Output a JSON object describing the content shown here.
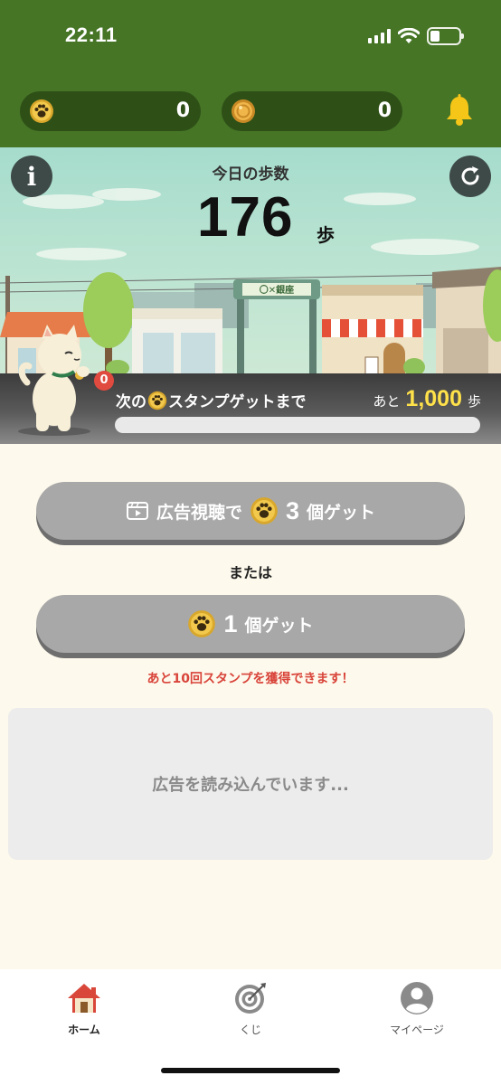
{
  "status_bar": {
    "time": "22:11"
  },
  "header": {
    "paw_count": "0",
    "coin_count": "0",
    "icons": {
      "paw": "paw-coin-icon",
      "coin": "gold-coin-icon",
      "bell": "bell-icon"
    }
  },
  "steps": {
    "title": "今日の歩数",
    "value": "176",
    "unit": "歩",
    "street_sign": "〇✕銀座"
  },
  "progress": {
    "badge_count": "0",
    "label_prefix": "次の",
    "label_suffix": "スタンプゲットまで",
    "remain_prefix": "あと",
    "remain_value": "1,000",
    "remain_unit": "歩",
    "fraction": 0
  },
  "actions": {
    "ad_button": {
      "prefix": "広告視聴で",
      "count": "3",
      "suffix": "個ゲット"
    },
    "or_label": "または",
    "one_button": {
      "count": "1",
      "suffix": "個ゲット"
    },
    "remaining_note": "あと10回スタンプを獲得できます！"
  },
  "ad_placeholder": "広告を読み込んでいます...",
  "tabs": [
    {
      "label": "ホーム",
      "icon": "home-icon",
      "active": true
    },
    {
      "label": "くじ",
      "icon": "target-icon",
      "active": false
    },
    {
      "label": "マイページ",
      "icon": "user-icon",
      "active": false
    }
  ],
  "colors": {
    "header_green": "#467526",
    "pill_dark": "#2e5017",
    "accent_yellow": "#ffe14a",
    "note_red": "#d9443a",
    "button_gray": "#a8a8a8",
    "page_bg": "#fdf9ec"
  }
}
